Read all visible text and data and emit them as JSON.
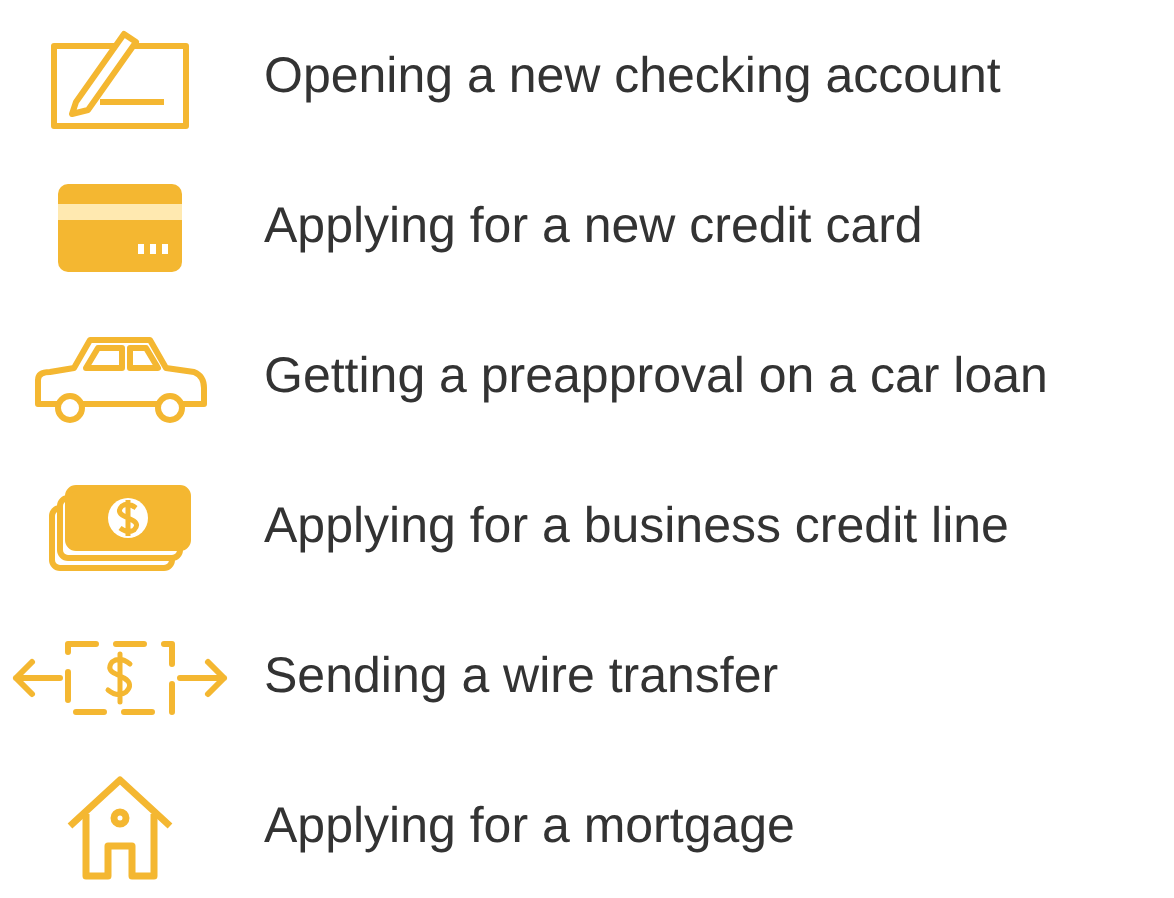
{
  "items": [
    {
      "label": "Opening a new checking account"
    },
    {
      "label": "Applying for a new credit card"
    },
    {
      "label": "Getting a preapproval on a car loan"
    },
    {
      "label": "Applying for a business credit line"
    },
    {
      "label": "Sending a wire transfer"
    },
    {
      "label": "Applying for a mortgage"
    }
  ]
}
